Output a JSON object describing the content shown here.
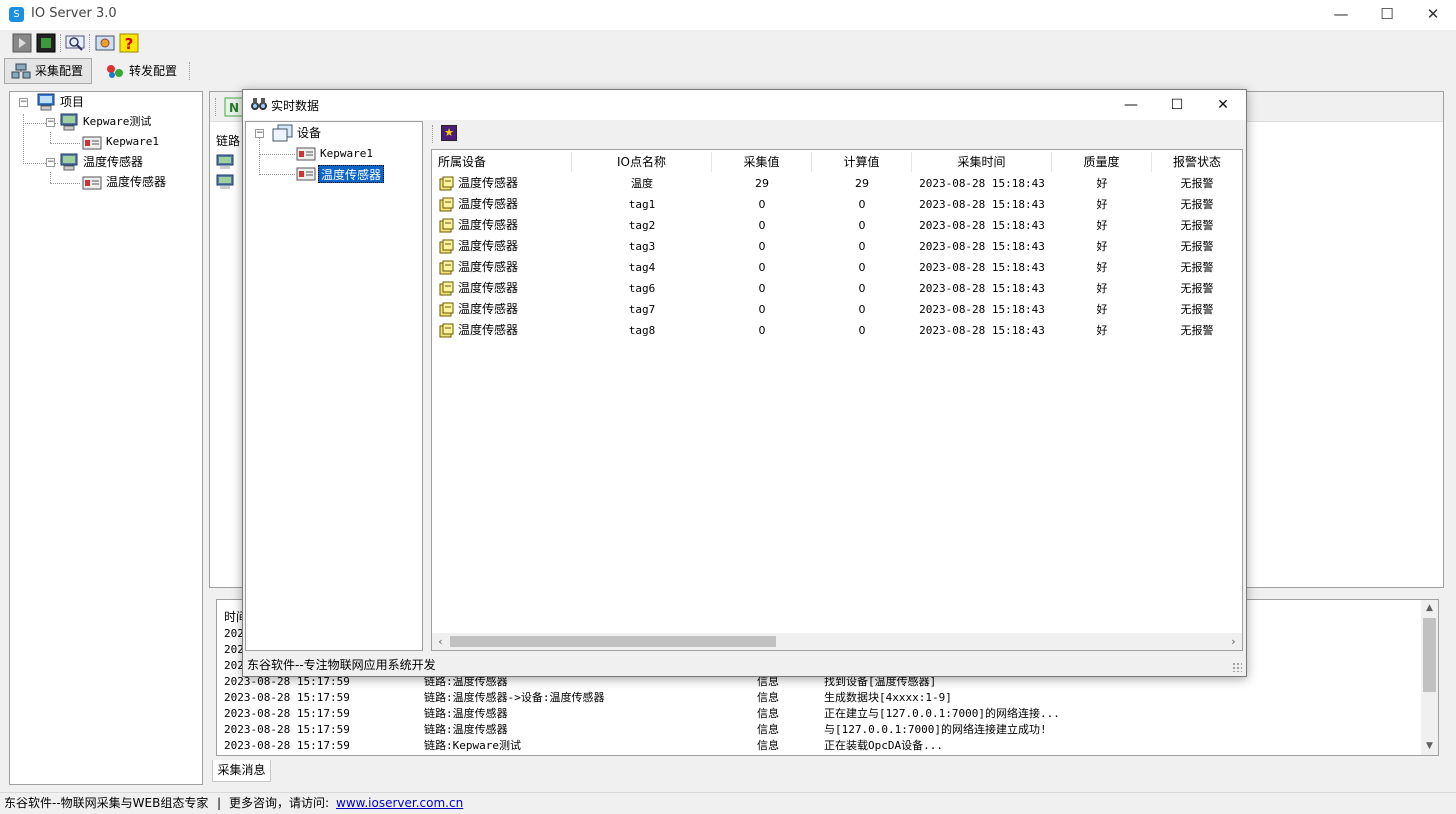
{
  "app": {
    "title": "IO Server 3.0",
    "icon": "S"
  },
  "window_controls": {
    "minimize": "—",
    "maximize": "☐",
    "close": "✕"
  },
  "toolbar": {
    "icons": [
      "run-icon",
      "stop-icon",
      "search-icon",
      "settings-icon",
      "help-icon"
    ]
  },
  "config_tabs": [
    {
      "label": "采集配置",
      "active": true
    },
    {
      "label": "转发配置",
      "active": false
    }
  ],
  "tree": {
    "root": "项目",
    "links": [
      {
        "label": "Kepware测试",
        "devices": [
          "Kepware1"
        ]
      },
      {
        "label": "温度传感器",
        "devices": [
          "温度传感器"
        ]
      }
    ]
  },
  "main": {
    "link_header": "链路"
  },
  "log": {
    "header": "时间",
    "rows": [
      {
        "time": "2023-08-28 15:17:59",
        "link": "链路:温度传感器",
        "level": "信息",
        "message": "找到设备[温度传感器]"
      },
      {
        "time": "2023-08-28 15:17:59",
        "link": "链路:温度传感器->设备:温度传感器",
        "level": "信息",
        "message": "生成数据块[4xxxx:1-9]"
      },
      {
        "time": "2023-08-28 15:17:59",
        "link": "链路:温度传感器",
        "level": "信息",
        "message": "正在建立与[127.0.0.1:7000]的网络连接..."
      },
      {
        "time": "2023-08-28 15:17:59",
        "link": "链路:温度传感器",
        "level": "信息",
        "message": "与[127.0.0.1:7000]的网络连接建立成功!"
      },
      {
        "time": "2023-08-28 15:17:59",
        "link": "链路:Kepware测试",
        "level": "信息",
        "message": "正在装载OpcDA设备..."
      }
    ],
    "partial_times": [
      "202",
      "202",
      "202"
    ],
    "tab_label": "采集消息"
  },
  "footer": {
    "company": "东谷软件--物联网采集与WEB组态专家",
    "separator": "|",
    "more": "更多咨询，请访问:",
    "link": "www.ioserver.com.cn"
  },
  "dialog": {
    "title": "实时数据",
    "tree": {
      "root": "设备",
      "items": [
        "Kepware1",
        "温度传感器"
      ],
      "selected": "温度传感器"
    },
    "columns": [
      "所属设备",
      "IO点名称",
      "采集值",
      "计算值",
      "采集时间",
      "质量度",
      "报警状态"
    ],
    "rows": [
      {
        "device": "温度传感器",
        "name": "温度",
        "raw": "29",
        "calc": "29",
        "time": "2023-08-28 15:18:43",
        "quality": "好",
        "alarm": "无报警"
      },
      {
        "device": "温度传感器",
        "name": "tag1",
        "raw": "0",
        "calc": "0",
        "time": "2023-08-28 15:18:43",
        "quality": "好",
        "alarm": "无报警"
      },
      {
        "device": "温度传感器",
        "name": "tag2",
        "raw": "0",
        "calc": "0",
        "time": "2023-08-28 15:18:43",
        "quality": "好",
        "alarm": "无报警"
      },
      {
        "device": "温度传感器",
        "name": "tag3",
        "raw": "0",
        "calc": "0",
        "time": "2023-08-28 15:18:43",
        "quality": "好",
        "alarm": "无报警"
      },
      {
        "device": "温度传感器",
        "name": "tag4",
        "raw": "0",
        "calc": "0",
        "time": "2023-08-28 15:18:43",
        "quality": "好",
        "alarm": "无报警"
      },
      {
        "device": "温度传感器",
        "name": "tag6",
        "raw": "0",
        "calc": "0",
        "time": "2023-08-28 15:18:43",
        "quality": "好",
        "alarm": "无报警"
      },
      {
        "device": "温度传感器",
        "name": "tag7",
        "raw": "0",
        "calc": "0",
        "time": "2023-08-28 15:18:43",
        "quality": "好",
        "alarm": "无报警"
      },
      {
        "device": "温度传感器",
        "name": "tag8",
        "raw": "0",
        "calc": "0",
        "time": "2023-08-28 15:18:43",
        "quality": "好",
        "alarm": "无报警"
      }
    ],
    "status": "东谷软件--专注物联网应用系统开发"
  }
}
